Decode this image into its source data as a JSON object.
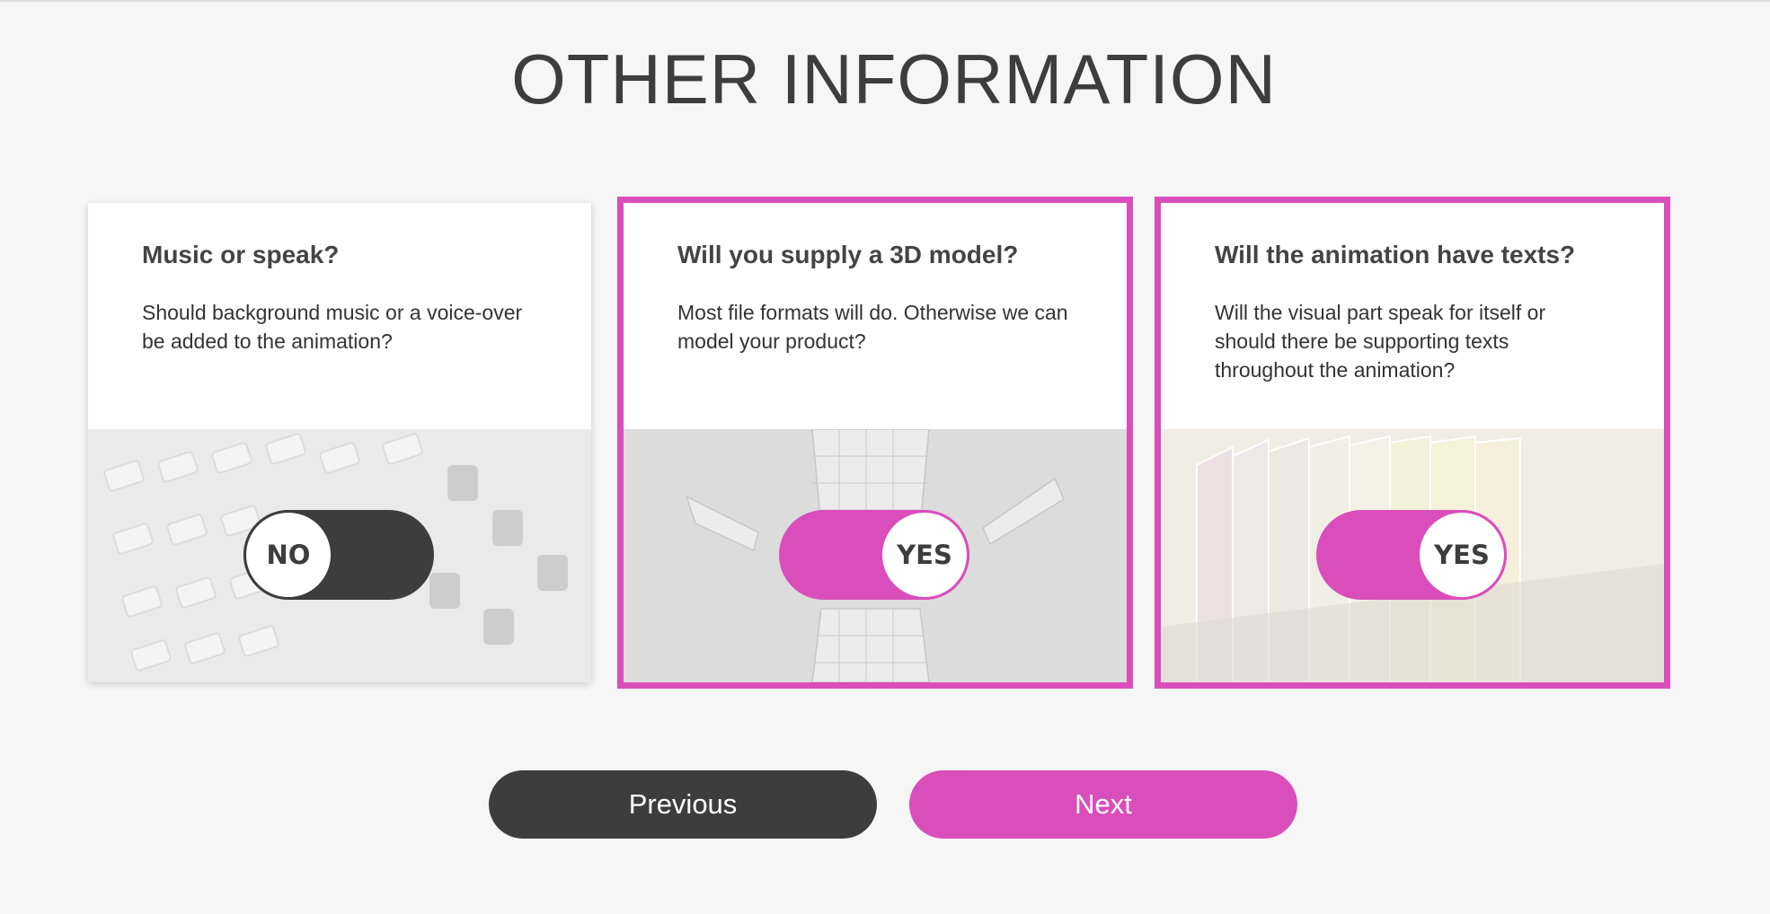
{
  "page": {
    "title": "OTHER INFORMATION"
  },
  "cards": [
    {
      "title": "Music or speak?",
      "description": "Should background music or a voice-over be added to the animation?",
      "toggle": {
        "label": "NO",
        "state": "off"
      },
      "image": "mixing-console-photo"
    },
    {
      "title": "Will you supply a 3D model?",
      "description": "Most file formats will do. Otherwise we can model your product?",
      "toggle": {
        "label": "YES",
        "state": "on"
      },
      "image": "3d-wireframe-model-photo"
    },
    {
      "title": "Will the animation have texts?",
      "description": "Will the visual part speak for itself or should there be supporting texts throughout the animation?",
      "toggle": {
        "label": "YES",
        "state": "on"
      },
      "image": "file-folders-photo"
    }
  ],
  "navigation": {
    "previous_label": "Previous",
    "next_label": "Next"
  },
  "colors": {
    "accent": "#d94ebb",
    "dark": "#3d3d3d",
    "background": "#f6f6f6"
  }
}
